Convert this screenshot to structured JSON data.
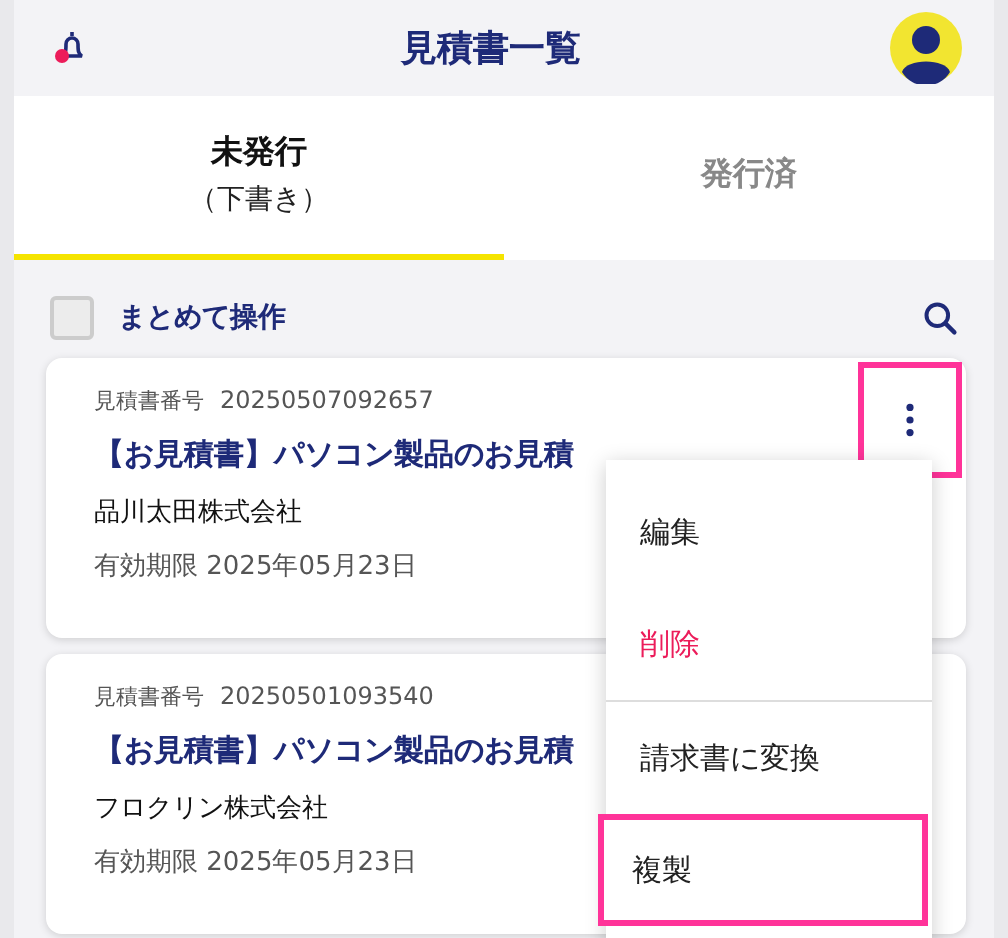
{
  "header": {
    "title": "見積書一覧"
  },
  "tabs": [
    {
      "label": "未発行",
      "sublabel": "（下書き）",
      "selected": true
    },
    {
      "label": "発行済",
      "selected": false
    }
  ],
  "bulk": {
    "label": "まとめて操作",
    "checked": false
  },
  "cards": [
    {
      "number_label": "見積書番号",
      "number": "20250507092657",
      "title": "【お見積書】パソコン製品のお見積",
      "company": "品川太田株式会社",
      "expiry": "有効期限 2025年05月23日",
      "more_button": {
        "highlighted": true
      }
    },
    {
      "number_label": "見積書番号",
      "number": "20250501093540",
      "title": "【お見積書】パソコン製品のお見積",
      "company": "フロクリン株式会社",
      "expiry": "有効期限 2025年05月23日"
    }
  ],
  "menu": {
    "items": [
      {
        "label": "編集",
        "kind": "normal",
        "highlighted": false
      },
      {
        "label": "削除",
        "kind": "danger",
        "highlighted": false
      },
      {
        "label": "請求書に変換",
        "kind": "normal",
        "highlighted": false
      },
      {
        "label": "複製",
        "kind": "normal",
        "highlighted": true
      }
    ]
  }
}
